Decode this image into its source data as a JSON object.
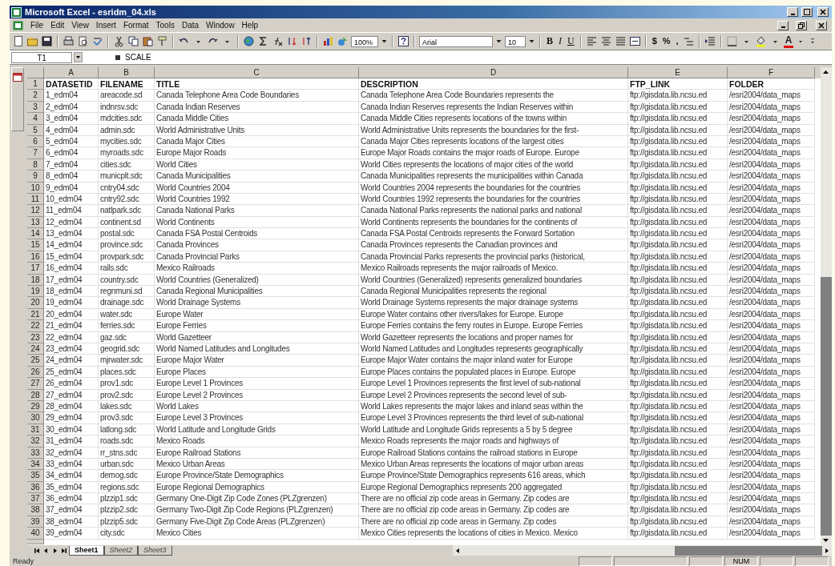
{
  "window": {
    "title": "Microsoft Excel - esridm_04.xls"
  },
  "menu": [
    "File",
    "Edit",
    "View",
    "Insert",
    "Format",
    "Tools",
    "Data",
    "Window",
    "Help"
  ],
  "toolbar": {
    "zoom": "100%",
    "font": "Arial",
    "size": "10",
    "styles": [
      "B",
      "I",
      "U"
    ],
    "number_formats": [
      "$",
      "%",
      ","
    ],
    "font_color": "A"
  },
  "formula_bar": {
    "name_box": "T1",
    "content": "SCALE"
  },
  "columns": [
    "A",
    "B",
    "C",
    "D",
    "E",
    "F"
  ],
  "rows": [
    {
      "row": "1",
      "kind": "header",
      "cells": [
        "DATASETID",
        "FILENAME",
        "TITLE",
        "DESCRIPTION",
        "FTP_LINK",
        "FOLDER"
      ]
    },
    {
      "row": "2",
      "kind": "data",
      "cells": [
        "1_edm04",
        "areacode.sd",
        "Canada Telephone Area Code Boundaries",
        "Canada Telephone Area Code Boundaries represents the",
        "ftp://gisdata.lib.ncsu.ed",
        "/esri2004/data_maps"
      ]
    },
    {
      "row": "3",
      "kind": "data",
      "cells": [
        "2_edm04",
        "indnrsv.sdc",
        "Canada Indian Reserves",
        "Canada Indian Reserves represents the Indian Reserves within",
        "ftp://gisdata.lib.ncsu.ed",
        "/esri2004/data_maps"
      ]
    },
    {
      "row": "4",
      "kind": "data",
      "cells": [
        "3_edm04",
        "mdcities.sdc",
        "Canada Middle Cities",
        "Canada Middle Cities represents locations of the towns within",
        "ftp://gisdata.lib.ncsu.ed",
        "/esri2004/data_maps"
      ]
    },
    {
      "row": "5",
      "kind": "data",
      "cells": [
        "4_edm04",
        "admin.sdc",
        "World Administrative Units",
        "World Administrative Units represents the boundaries for the first-",
        "ftp://gisdata.lib.ncsu.ed",
        "/esri2004/data_maps"
      ]
    },
    {
      "row": "6",
      "kind": "data",
      "cells": [
        "5_edm04",
        "mycities.sdc",
        "Canada Major Cities",
        "Canada Major Cities represents locations of the largest cities",
        "ftp://gisdata.lib.ncsu.ed",
        "/esri2004/data_maps"
      ]
    },
    {
      "row": "7",
      "kind": "data",
      "cells": [
        "6_edm04",
        "myroads.sdc",
        "Europe Major Roads",
        "Europe Major Roads contains the major roads of Europe.  Europe",
        "ftp://gisdata.lib.ncsu.ed",
        "/esri2004/data_maps"
      ]
    },
    {
      "row": "8",
      "kind": "data",
      "cells": [
        "7_edm04",
        "cities.sdc",
        "World Cities",
        "World Cities represents the locations of major cities of the world",
        "ftp://gisdata.lib.ncsu.ed",
        "/esri2004/data_maps"
      ]
    },
    {
      "row": "9",
      "kind": "data",
      "cells": [
        "8_edm04",
        "municplt.sdc",
        "Canada Municipalities",
        "Canada Municipalities represents the municipalities within Canada",
        "ftp://gisdata.lib.ncsu.ed",
        "/esri2004/data_maps"
      ]
    },
    {
      "row": "10",
      "kind": "data",
      "cells": [
        "9_edm04",
        "cntry04.sdc",
        "World Countries 2004",
        "World Countries 2004 represents the boundaries for the countries",
        "ftp://gisdata.lib.ncsu.ed",
        "/esri2004/data_maps"
      ]
    },
    {
      "row": "11",
      "kind": "data",
      "cells": [
        "10_edm04",
        "cntry92.sdc",
        "World Countries 1992",
        "World Countries 1992 represents the boundaries for the countries",
        "ftp://gisdata.lib.ncsu.ed",
        "/esri2004/data_maps"
      ]
    },
    {
      "row": "12",
      "kind": "data",
      "cells": [
        "11_edm04",
        "natlpark.sdc",
        "Canada National Parks",
        "Canada National Parks represents the national parks and national",
        "ftp://gisdata.lib.ncsu.ed",
        "/esri2004/data_maps"
      ]
    },
    {
      "row": "13",
      "kind": "data",
      "cells": [
        "12_edm04",
        "continent.sd",
        "World Continents",
        "World Continents represents the boundaries for the continents of",
        "ftp://gisdata.lib.ncsu.ed",
        "/esri2004/data_maps"
      ]
    },
    {
      "row": "14",
      "kind": "data",
      "cells": [
        "13_edm04",
        "postal.sdc",
        "Canada FSA Postal Centroids",
        "Canada FSA Postal Centroids represents the Forward Sortation",
        "ftp://gisdata.lib.ncsu.ed",
        "/esri2004/data_maps"
      ]
    },
    {
      "row": "15",
      "kind": "data",
      "cells": [
        "14_edm04",
        "province.sdc",
        "Canada Provinces",
        "Canada Provinces represents the Canadian provinces and",
        "ftp://gisdata.lib.ncsu.ed",
        "/esri2004/data_maps"
      ]
    },
    {
      "row": "16",
      "kind": "data",
      "cells": [
        "15_edm04",
        "provpark.sdc",
        "Canada Provincial Parks",
        "Canada Provincial Parks represents the provincial parks (historical,",
        "ftp://gisdata.lib.ncsu.ed",
        "/esri2004/data_maps"
      ]
    },
    {
      "row": "17",
      "kind": "data",
      "cells": [
        "16_edm04",
        "rails.sdc",
        "Mexico Railroads",
        "Mexico Railroads represents the major railroads of Mexico.",
        "ftp://gisdata.lib.ncsu.ed",
        "/esri2004/data_maps"
      ]
    },
    {
      "row": "18",
      "kind": "data",
      "cells": [
        "17_edm04",
        "country.sdc",
        "World Countries (Generalized)",
        "World Countries (Generalized) represents generalized boundaries",
        "ftp://gisdata.lib.ncsu.ed",
        "/esri2004/data_maps"
      ]
    },
    {
      "row": "19",
      "kind": "data",
      "cells": [
        "18_edm04",
        "regnmuni.sd",
        "Canada Regional Municipalities",
        "Canada Regional Municipalities represents the regional",
        "ftp://gisdata.lib.ncsu.ed",
        "/esri2004/data_maps"
      ]
    },
    {
      "row": "20",
      "kind": "data",
      "cells": [
        "19_edm04",
        "drainage.sdc",
        "World Drainage Systems",
        "World Drainage Systems represents the major drainage systems",
        "ftp://gisdata.lib.ncsu.ed",
        "/esri2004/data_maps"
      ]
    },
    {
      "row": "21",
      "kind": "data",
      "cells": [
        "20_edm04",
        "water.sdc",
        "Europe Water",
        "Europe Water contains other rivers/lakes for Europe.  Europe",
        "ftp://gisdata.lib.ncsu.ed",
        "/esri2004/data_maps"
      ]
    },
    {
      "row": "22",
      "kind": "data",
      "cells": [
        "21_edm04",
        "ferries.sdc",
        "Europe Ferries",
        "Europe Ferries contains the ferry routes in Europe.  Europe Ferries",
        "ftp://gisdata.lib.ncsu.ed",
        "/esri2004/data_maps"
      ]
    },
    {
      "row": "23",
      "kind": "data",
      "cells": [
        "22_edm04",
        "gaz.sdc",
        "World Gazetteer",
        "World Gazetteer represents the locations and proper names for",
        "ftp://gisdata.lib.ncsu.ed",
        "/esri2004/data_maps"
      ]
    },
    {
      "row": "24",
      "kind": "data",
      "cells": [
        "23_edm04",
        "geogrid.sdc",
        "World Named Latitudes and Longitudes",
        "World Named Latitudes and Longitudes represents geographically",
        "ftp://gisdata.lib.ncsu.ed",
        "/esri2004/data_maps"
      ]
    },
    {
      "row": "25",
      "kind": "data",
      "cells": [
        "24_edm04",
        "mjrwater.sdc",
        "Europe Major Water",
        "Europe Major Water contains the major inland water for Europe",
        "ftp://gisdata.lib.ncsu.ed",
        "/esri2004/data_maps"
      ]
    },
    {
      "row": "26",
      "kind": "data",
      "cells": [
        "25_edm04",
        "places.sdc",
        "Europe Places",
        "Europe Places contains the populated places in Europe.  Europe",
        "ftp://gisdata.lib.ncsu.ed",
        "/esri2004/data_maps"
      ]
    },
    {
      "row": "27",
      "kind": "data",
      "cells": [
        "26_edm04",
        "prov1.sdc",
        "Europe Level 1 Provinces",
        "Europe Level 1 Provinces represents the first level of sub-national",
        "ftp://gisdata.lib.ncsu.ed",
        "/esri2004/data_maps"
      ]
    },
    {
      "row": "28",
      "kind": "data",
      "cells": [
        "27_edm04",
        "prov2.sdc",
        "Europe Level 2 Provinces",
        "Europe Level 2 Provinces represents the second level of sub-",
        "ftp://gisdata.lib.ncsu.ed",
        "/esri2004/data_maps"
      ]
    },
    {
      "row": "29",
      "kind": "data",
      "cells": [
        "28_edm04",
        "lakes.sdc",
        "World Lakes",
        "World Lakes represents the major lakes and inland seas within the",
        "ftp://gisdata.lib.ncsu.ed",
        "/esri2004/data_maps"
      ]
    },
    {
      "row": "30",
      "kind": "data",
      "cells": [
        "29_edm04",
        "prov3.sdc",
        "Europe Level 3 Provinces",
        "Europe Level 3 Provinces represents the third level of sub-national",
        "ftp://gisdata.lib.ncsu.ed",
        "/esri2004/data_maps"
      ]
    },
    {
      "row": "31",
      "kind": "data",
      "cells": [
        "30_edm04",
        "latlong.sdc",
        "World Latitude and Longitude Grids",
        "World Latitude and Longitude Grids represents a 5 by 5 degree",
        "ftp://gisdata.lib.ncsu.ed",
        "/esri2004/data_maps"
      ]
    },
    {
      "row": "32",
      "kind": "data",
      "cells": [
        "31_edm04",
        "roads.sdc",
        "Mexico Roads",
        "Mexico Roads represents the major roads and highways of",
        "ftp://gisdata.lib.ncsu.ed",
        "/esri2004/data_maps"
      ]
    },
    {
      "row": "33",
      "kind": "data",
      "cells": [
        "32_edm04",
        "rr_stns.sdc",
        "Europe Railroad Stations",
        "Europe Railroad Stations contains the railroad stations in Europe",
        "ftp://gisdata.lib.ncsu.ed",
        "/esri2004/data_maps"
      ]
    },
    {
      "row": "34",
      "kind": "data",
      "cells": [
        "33_edm04",
        "urban.sdc",
        "Mexico Urban Areas",
        "Mexico Urban Areas represents the locations of major urban areas",
        "ftp://gisdata.lib.ncsu.ed",
        "/esri2004/data_maps"
      ]
    },
    {
      "row": "35",
      "kind": "data",
      "cells": [
        "34_edm04",
        "demog.sdc",
        "Europe Province/State Demographics",
        "Europe Province/State Demographics represents 616 areas, which",
        "ftp://gisdata.lib.ncsu.ed",
        "/esri2004/data_maps"
      ]
    },
    {
      "row": "36",
      "kind": "data",
      "cells": [
        "35_edm04",
        "regions.sdc",
        "Europe Regional Demographics",
        "Europe Regional Demographics represents 200 aggregated",
        "ftp://gisdata.lib.ncsu.ed",
        "/esri2004/data_maps"
      ]
    },
    {
      "row": "37",
      "kind": "data",
      "cells": [
        "36_edm04",
        "plzzip1.sdc",
        "Germany One-Digit Zip Code Zones (PLZgrenzen)",
        "There are no official zip code areas in Germany.  Zip codes are",
        "ftp://gisdata.lib.ncsu.ed",
        "/esri2004/data_maps"
      ]
    },
    {
      "row": "38",
      "kind": "data",
      "cells": [
        "37_edm04",
        "plzzip2.sdc",
        "Germany Two-Digit Zip Code Regions (PLZgrenzen)",
        "There are no official zip code areas in Germany.  Zip codes are",
        "ftp://gisdata.lib.ncsu.ed",
        "/esri2004/data_maps"
      ]
    },
    {
      "row": "39",
      "kind": "data",
      "cells": [
        "38_edm04",
        "plzzip5.sdc",
        "Germany Five-Digit Zip Code Areas (PLZgrenzen)",
        "There are no official zip code areas in Germany.  Zip codes",
        "ftp://gisdata.lib.ncsu.ed",
        "/esri2004/data_maps"
      ]
    },
    {
      "row": "40",
      "kind": "data",
      "cells": [
        "39_edm04",
        "city.sdc",
        "Mexico Cities",
        "Mexico Cities represents the locations of cities in Mexico.  Mexico",
        "ftp://gisdata.lib.ncsu.ed",
        "/esri2004/data_maps"
      ]
    }
  ],
  "sheet_tabs": [
    {
      "label": "Sheet1",
      "selected": true
    },
    {
      "label": "Sheet2",
      "selected": false
    },
    {
      "label": "Sheet3",
      "selected": false
    }
  ],
  "status_bar": {
    "status": "Ready",
    "num_lock": "NUM"
  }
}
